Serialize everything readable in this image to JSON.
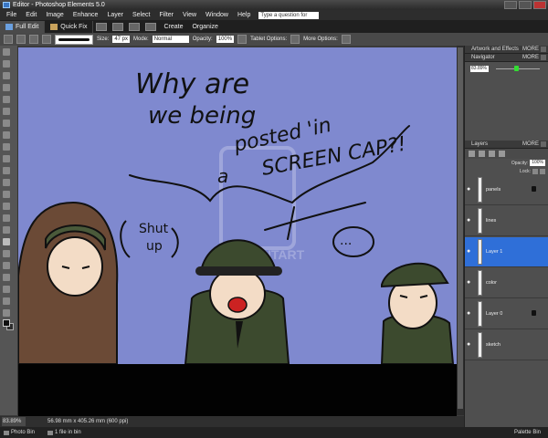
{
  "titlebar": {
    "title": "Editor - Photoshop Elements 5.0"
  },
  "menu": {
    "items": [
      "File",
      "Edit",
      "Image",
      "Enhance",
      "Layer",
      "Select",
      "Filter",
      "View",
      "Window",
      "Help"
    ],
    "help_placeholder": "Type a question for help"
  },
  "modebar": {
    "full_edit": "Full Edit",
    "quick_fix": "Quick Fix",
    "create": "Create",
    "organize": "Organize"
  },
  "options": {
    "size_label": "Size:",
    "size_value": "47 px",
    "mode_label": "Mode:",
    "mode_value": "Normal",
    "opacity_label": "Opacity:",
    "opacity_value": "100%",
    "tablet_options": "Tablet Options:",
    "more_options": "More Options:"
  },
  "artwork": {
    "text_line1": "Why are",
    "text_line2": "we being",
    "text_line3": "posted 'in",
    "text_line4": "SCREEN CAP?!",
    "text_line5": "a",
    "shut_up_line1": "Shut",
    "shut_up_line2": "up",
    "dots": "...",
    "watermark": "DEVIANTART"
  },
  "status": {
    "zoom": "83.89%",
    "dimensions": "56.98 mm x 405.26 mm (600 ppi)"
  },
  "binbar": {
    "photo_bin": "Photo Bin",
    "file_count": "1 file in bin",
    "palette_bin": "Palette Bin"
  },
  "panels": {
    "artwork_effects": "Artwork and Effects",
    "navigator": "Navigator",
    "navigator_zoom": "83.89%",
    "layers": "Layers",
    "more": "MORE",
    "opacity_label": "Opacity:",
    "opacity_value": "100%",
    "lock_label": "Lock:",
    "layers_list": [
      {
        "name": "panels",
        "locked": true,
        "active": false
      },
      {
        "name": "lines",
        "locked": false,
        "active": false
      },
      {
        "name": "Layer 1",
        "locked": false,
        "active": true
      },
      {
        "name": "color",
        "locked": false,
        "active": false
      },
      {
        "name": "Layer 0",
        "locked": true,
        "active": false
      },
      {
        "name": "sketch",
        "locked": false,
        "active": false
      }
    ]
  },
  "colors": {
    "canvas_blue": "#7f89cf",
    "active_layer": "#2f6fd8"
  }
}
